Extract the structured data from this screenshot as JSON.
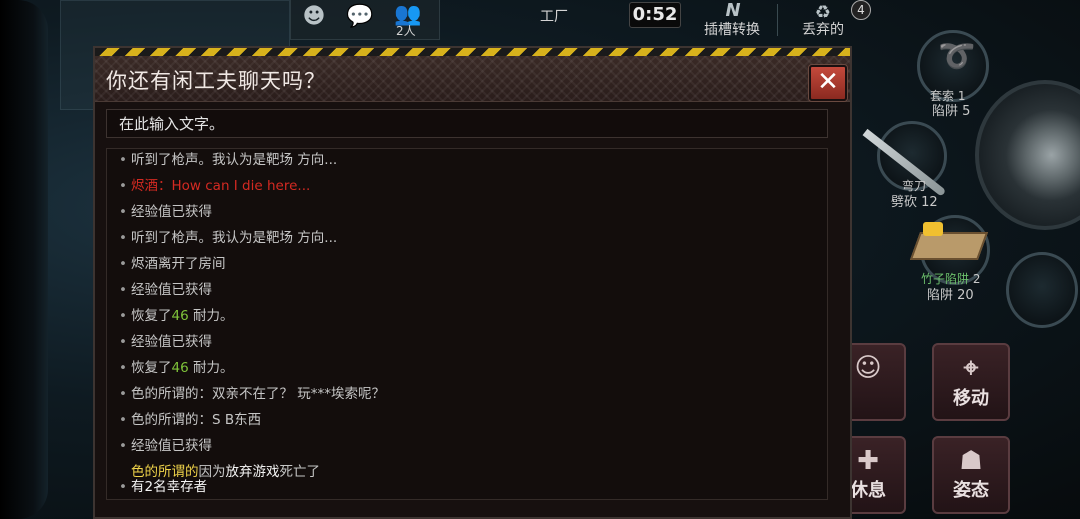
{
  "hud": {
    "players_count": "2人",
    "area_name": "工厂",
    "timer": "0:52",
    "slot_switch_label": "插槽转换",
    "discard_label": "丢弃的",
    "discard_count": "4"
  },
  "inventory": {
    "rope_name": "套索",
    "rope_count": "1",
    "rope_stat": "陷阱 5",
    "machete_name": "弯刀",
    "machete_stat": "劈砍 12",
    "trap_name": "竹子陷阱",
    "trap_count": "2",
    "trap_stat": "陷阱 20"
  },
  "actions": {
    "move_label": "移动",
    "rest_label": "休息",
    "pose_label": "姿态"
  },
  "chat_modal": {
    "title": "你还有闲工夫聊天吗？",
    "close_label": "✕",
    "input_placeholder": "在此输入文字。",
    "messages": [
      {
        "text": "听到了枪声。我认为是靶场 方向..."
      },
      {
        "name": "烬酒",
        "sep": "：",
        "text": "How can I die here..."
      },
      {
        "text": "经验值已获得"
      },
      {
        "text": "听到了枪声。我认为是靶场 方向..."
      },
      {
        "text": "烬酒离开了房间"
      },
      {
        "text": "经验值已获得"
      },
      {
        "pre": "恢复了",
        "num": "46",
        "post": " 耐力。"
      },
      {
        "text": "经验值已获得"
      },
      {
        "pre": "恢复了",
        "num": "46",
        "post": " 耐力。"
      },
      {
        "text": "色的所谓的：双亲不在了？  玩***埃索呢？"
      },
      {
        "text": "色的所谓的：S   B东西"
      },
      {
        "text": "经验值已获得"
      },
      {
        "name": "色的所谓的",
        "mid": "因为",
        "bold": "放弃游戏",
        "tail": "死亡了"
      }
    ],
    "survivors": "有2名幸存者"
  },
  "colors": {
    "hazard_yellow": "#d8b21c",
    "close_red": "#c54a3c",
    "system_red": "#d42a22",
    "stamina_green": "#7fc33a",
    "player_yellow": "#f0d44a"
  }
}
